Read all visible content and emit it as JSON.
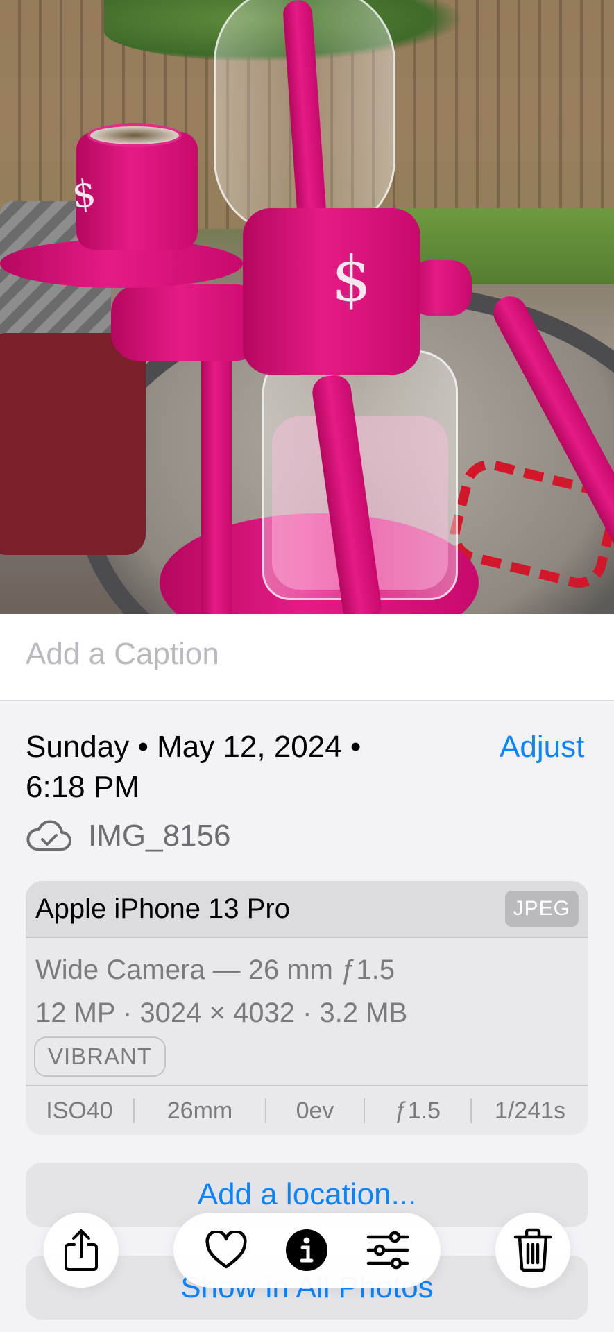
{
  "photo": {
    "description_icons": [
      "pink-water-pipe"
    ],
    "accent_color": "#e51b86"
  },
  "caption": {
    "placeholder": "Add a Caption"
  },
  "info": {
    "date_line": "Sunday • May 12, 2024 •",
    "time_line": "6:18 PM",
    "adjust_label": "Adjust",
    "filename": "IMG_8156",
    "cloud_icon": "icloud-check-icon"
  },
  "camera": {
    "device": "Apple iPhone 13 Pro",
    "format": "JPEG",
    "lens": "Wide Camera — 26 mm ƒ1.5",
    "specs": "12 MP · 3024 × 4032 · 3.2 MB",
    "style": "VIBRANT",
    "exif": [
      "ISO40",
      "26mm",
      "0ev",
      "ƒ1.5",
      "1/241s"
    ]
  },
  "actions": {
    "add_location": "Add a location...",
    "show_all": "Show in All Photos"
  },
  "toolbar": {
    "icons": [
      "share-icon",
      "heart-icon",
      "info-icon",
      "adjustments-icon",
      "trash-icon"
    ]
  },
  "colors": {
    "link": "#0a84ff",
    "background": "#f2f2f7"
  }
}
